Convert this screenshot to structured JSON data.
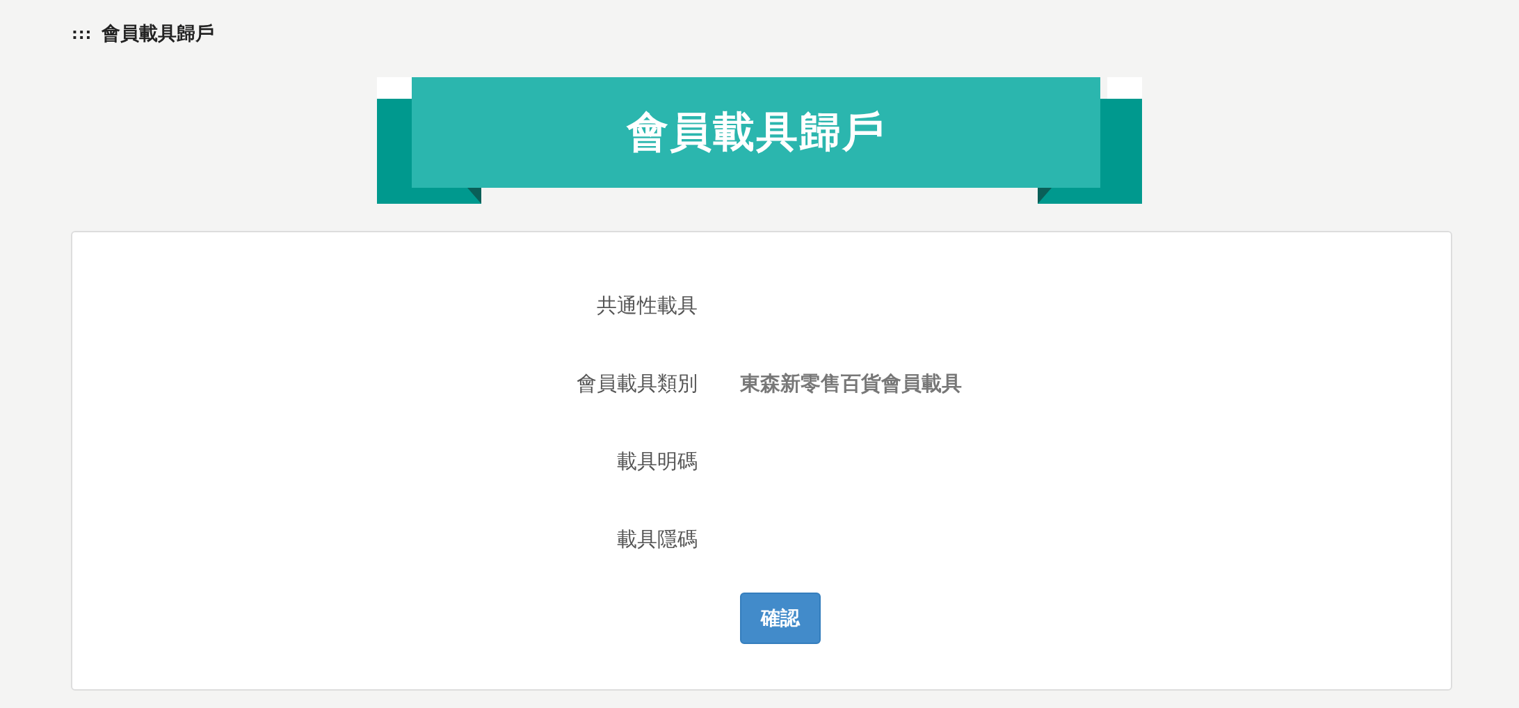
{
  "breadcrumb": {
    "marker": ":::",
    "label": "會員載具歸戶"
  },
  "banner": {
    "title": "會員載具歸戶"
  },
  "form": {
    "rows": [
      {
        "label": "共通性載具"
      },
      {
        "label": "會員載具類別",
        "value": "東森新零售百貨會員載具"
      },
      {
        "label": "載具明碼"
      },
      {
        "label": "載具隱碼"
      }
    ],
    "submit": "確認"
  }
}
